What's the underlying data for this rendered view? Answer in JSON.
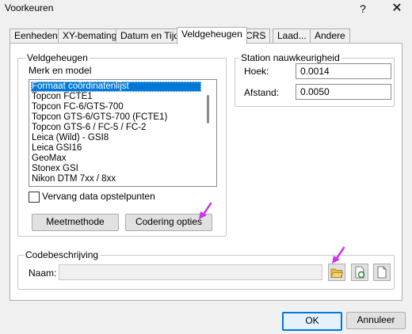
{
  "window": {
    "title": "Voorkeuren",
    "help": "?",
    "close": "✕"
  },
  "tabs": [
    "Eenheden",
    "XY-bemating",
    "Datum en Tijd",
    "Veldgeheugen",
    "CRS",
    "Laad...",
    "Andere"
  ],
  "active_tab": "Veldgeheugen",
  "veldgeheugen": {
    "group_label": "Veldgeheugen",
    "model_label": "Merk en model",
    "items": [
      "Formaat coördinatenlijst",
      "Topcon FCTE1",
      "Topcon FC-6/GTS-700",
      "Topcon GTS-6/GTS-700 (FCTE1)",
      "Topcon GTS-6 / FC-5 / FC-2",
      "Leica (Wild) - GSI8",
      "Leica GSI16",
      "GeoMax",
      "Stonex GSI",
      "Nikon DTM 7xx / 8xx"
    ],
    "selected_index": 0,
    "replace_checkbox_label": "Vervang data opstelpunten",
    "replace_checked": false,
    "meetmethode_button": "Meetmethode",
    "codering_button": "Codering opties"
  },
  "station": {
    "group_label": "Station nauwkeurigheid",
    "hoek_label": "Hoek:",
    "hoek_value": "0.0014",
    "afstand_label": "Afstand:",
    "afstand_value": "0.0050"
  },
  "codebeschrijving": {
    "group_label": "Codebeschrijving",
    "naam_label": "Naam:",
    "naam_value": "",
    "icons": [
      "open-folder-icon",
      "refresh-document-icon",
      "new-document-icon"
    ]
  },
  "buttons": {
    "ok": "OK",
    "cancel": "Annuleer"
  },
  "annotations": {
    "arrow_color": "#cc33ee"
  }
}
